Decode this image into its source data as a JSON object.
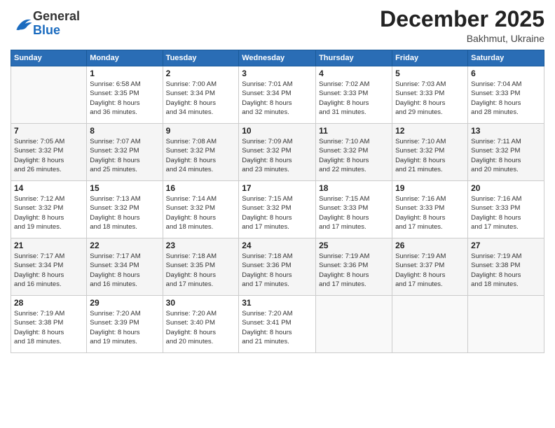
{
  "header": {
    "logo_general": "General",
    "logo_blue": "Blue",
    "month_title": "December 2025",
    "location": "Bakhmut, Ukraine"
  },
  "weekdays": [
    "Sunday",
    "Monday",
    "Tuesday",
    "Wednesday",
    "Thursday",
    "Friday",
    "Saturday"
  ],
  "weeks": [
    [
      {
        "day": "",
        "info": ""
      },
      {
        "day": "1",
        "info": "Sunrise: 6:58 AM\nSunset: 3:35 PM\nDaylight: 8 hours\nand 36 minutes."
      },
      {
        "day": "2",
        "info": "Sunrise: 7:00 AM\nSunset: 3:34 PM\nDaylight: 8 hours\nand 34 minutes."
      },
      {
        "day": "3",
        "info": "Sunrise: 7:01 AM\nSunset: 3:34 PM\nDaylight: 8 hours\nand 32 minutes."
      },
      {
        "day": "4",
        "info": "Sunrise: 7:02 AM\nSunset: 3:33 PM\nDaylight: 8 hours\nand 31 minutes."
      },
      {
        "day": "5",
        "info": "Sunrise: 7:03 AM\nSunset: 3:33 PM\nDaylight: 8 hours\nand 29 minutes."
      },
      {
        "day": "6",
        "info": "Sunrise: 7:04 AM\nSunset: 3:33 PM\nDaylight: 8 hours\nand 28 minutes."
      }
    ],
    [
      {
        "day": "7",
        "info": "Sunrise: 7:05 AM\nSunset: 3:32 PM\nDaylight: 8 hours\nand 26 minutes."
      },
      {
        "day": "8",
        "info": "Sunrise: 7:07 AM\nSunset: 3:32 PM\nDaylight: 8 hours\nand 25 minutes."
      },
      {
        "day": "9",
        "info": "Sunrise: 7:08 AM\nSunset: 3:32 PM\nDaylight: 8 hours\nand 24 minutes."
      },
      {
        "day": "10",
        "info": "Sunrise: 7:09 AM\nSunset: 3:32 PM\nDaylight: 8 hours\nand 23 minutes."
      },
      {
        "day": "11",
        "info": "Sunrise: 7:10 AM\nSunset: 3:32 PM\nDaylight: 8 hours\nand 22 minutes."
      },
      {
        "day": "12",
        "info": "Sunrise: 7:10 AM\nSunset: 3:32 PM\nDaylight: 8 hours\nand 21 minutes."
      },
      {
        "day": "13",
        "info": "Sunrise: 7:11 AM\nSunset: 3:32 PM\nDaylight: 8 hours\nand 20 minutes."
      }
    ],
    [
      {
        "day": "14",
        "info": "Sunrise: 7:12 AM\nSunset: 3:32 PM\nDaylight: 8 hours\nand 19 minutes."
      },
      {
        "day": "15",
        "info": "Sunrise: 7:13 AM\nSunset: 3:32 PM\nDaylight: 8 hours\nand 18 minutes."
      },
      {
        "day": "16",
        "info": "Sunrise: 7:14 AM\nSunset: 3:32 PM\nDaylight: 8 hours\nand 18 minutes."
      },
      {
        "day": "17",
        "info": "Sunrise: 7:15 AM\nSunset: 3:32 PM\nDaylight: 8 hours\nand 17 minutes."
      },
      {
        "day": "18",
        "info": "Sunrise: 7:15 AM\nSunset: 3:33 PM\nDaylight: 8 hours\nand 17 minutes."
      },
      {
        "day": "19",
        "info": "Sunrise: 7:16 AM\nSunset: 3:33 PM\nDaylight: 8 hours\nand 17 minutes."
      },
      {
        "day": "20",
        "info": "Sunrise: 7:16 AM\nSunset: 3:33 PM\nDaylight: 8 hours\nand 17 minutes."
      }
    ],
    [
      {
        "day": "21",
        "info": "Sunrise: 7:17 AM\nSunset: 3:34 PM\nDaylight: 8 hours\nand 16 minutes."
      },
      {
        "day": "22",
        "info": "Sunrise: 7:17 AM\nSunset: 3:34 PM\nDaylight: 8 hours\nand 16 minutes."
      },
      {
        "day": "23",
        "info": "Sunrise: 7:18 AM\nSunset: 3:35 PM\nDaylight: 8 hours\nand 17 minutes."
      },
      {
        "day": "24",
        "info": "Sunrise: 7:18 AM\nSunset: 3:36 PM\nDaylight: 8 hours\nand 17 minutes."
      },
      {
        "day": "25",
        "info": "Sunrise: 7:19 AM\nSunset: 3:36 PM\nDaylight: 8 hours\nand 17 minutes."
      },
      {
        "day": "26",
        "info": "Sunrise: 7:19 AM\nSunset: 3:37 PM\nDaylight: 8 hours\nand 17 minutes."
      },
      {
        "day": "27",
        "info": "Sunrise: 7:19 AM\nSunset: 3:38 PM\nDaylight: 8 hours\nand 18 minutes."
      }
    ],
    [
      {
        "day": "28",
        "info": "Sunrise: 7:19 AM\nSunset: 3:38 PM\nDaylight: 8 hours\nand 18 minutes."
      },
      {
        "day": "29",
        "info": "Sunrise: 7:20 AM\nSunset: 3:39 PM\nDaylight: 8 hours\nand 19 minutes."
      },
      {
        "day": "30",
        "info": "Sunrise: 7:20 AM\nSunset: 3:40 PM\nDaylight: 8 hours\nand 20 minutes."
      },
      {
        "day": "31",
        "info": "Sunrise: 7:20 AM\nSunset: 3:41 PM\nDaylight: 8 hours\nand 21 minutes."
      },
      {
        "day": "",
        "info": ""
      },
      {
        "day": "",
        "info": ""
      },
      {
        "day": "",
        "info": ""
      }
    ]
  ]
}
